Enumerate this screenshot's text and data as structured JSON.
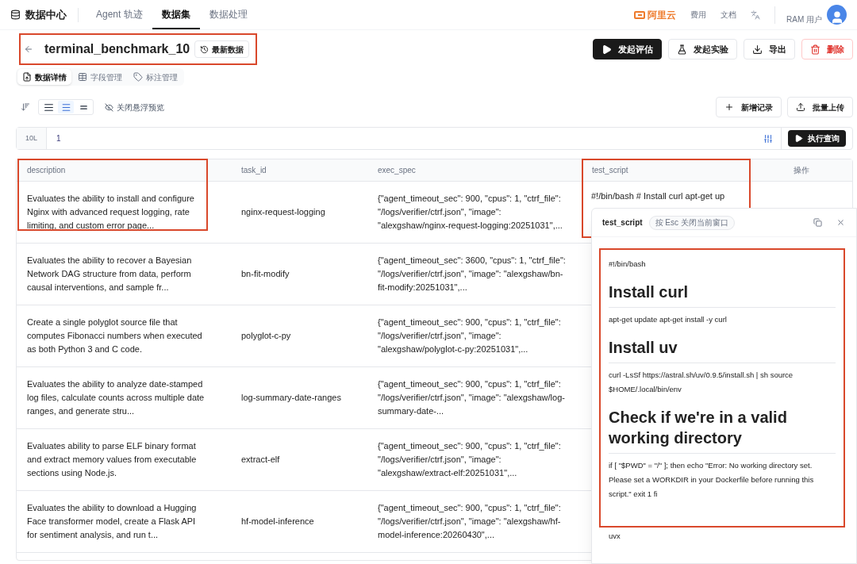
{
  "nav": {
    "brand": "数据中心",
    "items": [
      {
        "label": "Agent 轨迹",
        "selected": false
      },
      {
        "label": "数据集",
        "selected": true
      },
      {
        "label": "数据处理",
        "selected": false
      }
    ],
    "cloud_logo": "阿里云",
    "links": [
      "费用",
      "文档"
    ],
    "user": "RAM 用户"
  },
  "header": {
    "title": "terminal_benchmark_10",
    "version_button": "最新数据",
    "highlighted": true,
    "actions": [
      {
        "label": "发起评估",
        "kind": "primary"
      },
      {
        "label": "发起实验",
        "kind": "experiment"
      },
      {
        "label": "导出",
        "kind": "export"
      },
      {
        "label": "删除",
        "kind": "danger"
      }
    ]
  },
  "tabs": [
    {
      "label": "数据详情",
      "kind": "details",
      "selected": true
    },
    {
      "label": "字段管理",
      "kind": "fields",
      "selected": false
    },
    {
      "label": "标注管理",
      "kind": "labels",
      "selected": false
    }
  ],
  "toolbar": {
    "density": [
      {
        "kind": "compact",
        "selected": false
      },
      {
        "kind": "normal",
        "selected": true
      },
      {
        "kind": "loose",
        "selected": false
      }
    ],
    "preview_toggle": "关闭悬浮预览",
    "buttons": [
      {
        "label": "新增记录",
        "kind": "add"
      },
      {
        "label": "批量上传",
        "kind": "upload"
      }
    ]
  },
  "query": {
    "limit": "10L",
    "value": "1",
    "run_button": "执行查询"
  },
  "table": {
    "columns": [
      {
        "label": "description",
        "highlighted": true
      },
      {
        "label": "task_id"
      },
      {
        "label": "exec_spec"
      },
      {
        "label": "test_script",
        "highlighted": true
      },
      {
        "label": "操作"
      }
    ],
    "rows": [
      {
        "description": "Evaluates the ability to install and configure Nginx with advanced request logging, rate limiting, and custom error page...",
        "task_id": "nginx-request-logging",
        "exec_spec": "{\"agent_timeout_sec\": 900, \"cpus\": 1, \"ctrf_file\": \"/logs/verifier/ctrf.json\", \"image\": \"alexgshaw/nginx-request-logging:20251031\",...",
        "test_script": "#!/bin/bash # Install curl apt-get up"
      },
      {
        "description": "Evaluates the ability to recover a Bayesian Network DAG structure from data, perform causal interventions, and sample fr...",
        "task_id": "bn-fit-modify",
        "exec_spec": "{\"agent_timeout_sec\": 3600, \"cpus\": 1, \"ctrf_file\": \"/logs/verifier/ctrf.json\", \"image\": \"alexgshaw/bn-fit-modify:20251031\",..."
      },
      {
        "description": "Create a single polyglot source file that computes Fibonacci numbers when executed as both Python 3 and C code.",
        "task_id": "polyglot-c-py",
        "exec_spec": "{\"agent_timeout_sec\": 900, \"cpus\": 1, \"ctrf_file\": \"/logs/verifier/ctrf.json\", \"image\": \"alexgshaw/polyglot-c-py:20251031\",..."
      },
      {
        "description": "Evaluates the ability to analyze date-stamped log files, calculate counts across multiple date ranges, and generate stru...",
        "task_id": "log-summary-date-ranges",
        "exec_spec": "{\"agent_timeout_sec\": 900, \"cpus\": 1, \"ctrf_file\": \"/logs/verifier/ctrf.json\", \"image\": \"alexgshaw/log-summary-date-..."
      },
      {
        "description": "Evaluates ability to parse ELF binary format and extract memory values from executable sections using Node.js.",
        "task_id": "extract-elf",
        "exec_spec": "{\"agent_timeout_sec\": 900, \"cpus\": 1, \"ctrf_file\": \"/logs/verifier/ctrf.json\", \"image\": \"alexgshaw/extract-elf:20251031\",..."
      },
      {
        "description": "Evaluates the ability to download a Hugging Face transformer model, create a Flask API for sentiment analysis, and run t...",
        "task_id": "hf-model-inference",
        "exec_spec": "{\"agent_timeout_sec\": 900, \"cpus\": 1, \"ctrf_file\": \"/logs/verifier/ctrf.json\", \"image\": \"alexgshaw/hf-model-inference:20260430\",..."
      }
    ]
  },
  "popup": {
    "title": "test_script",
    "hint": "按 Esc 关闭当前窗口",
    "highlighted": true,
    "content": [
      {
        "kind": "text",
        "text": "#!/bin/bash"
      },
      {
        "kind": "heading",
        "text": "Install curl"
      },
      {
        "kind": "text",
        "text": "apt-get update apt-get install -y curl"
      },
      {
        "kind": "heading",
        "text": "Install uv"
      },
      {
        "kind": "text",
        "text": "curl -LsSf https://astral.sh/uv/0.9.5/install.sh | sh source $HOME/.local/bin/env"
      },
      {
        "kind": "heading",
        "text": "Check if we're in a valid working directory"
      },
      {
        "kind": "text",
        "text": "if [ \"$PWD\" = \"/\" ]; then echo \"Error: No working directory set. Please set a WORKDIR in your Dockerfile before running this script.\" exit 1 fi"
      }
    ],
    "after": "uvx"
  }
}
